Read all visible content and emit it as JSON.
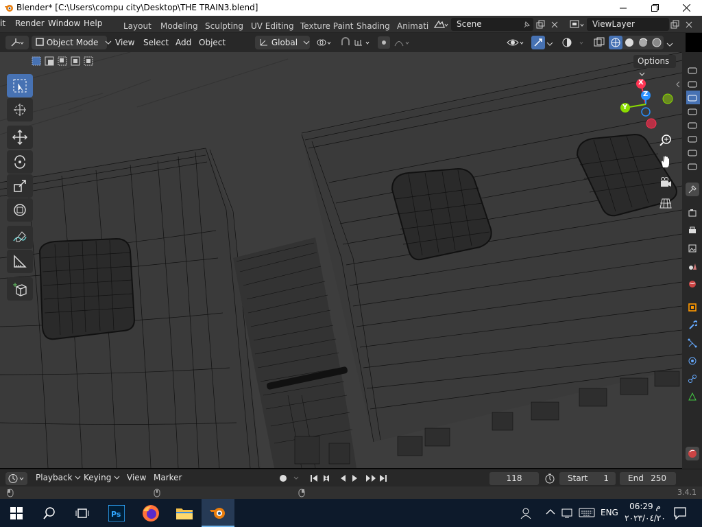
{
  "window": {
    "title": "Blender* [C:\\Users\\compu city\\Desktop\\THE TRAIN3.blend]"
  },
  "menu": {
    "items": [
      "it",
      "Render",
      "Window",
      "Help"
    ]
  },
  "workspaces": [
    "Layout",
    "Modeling",
    "Sculpting",
    "UV Editing",
    "Texture Paint",
    "Shading",
    "Animati"
  ],
  "scene": {
    "name": "Scene"
  },
  "view_layer": {
    "name": "ViewLayer"
  },
  "header": {
    "mode": "Object Mode",
    "menus": [
      "View",
      "Select",
      "Add",
      "Object"
    ],
    "transform_orientation": "Global",
    "options_label": "Options"
  },
  "gizmo": {
    "x_label": "X",
    "y_label": "Y",
    "z_label": "Z"
  },
  "timeline": {
    "menus": [
      "Playback",
      "Keying",
      "View",
      "Marker"
    ],
    "current_frame": "118",
    "start_label": "Start",
    "start_value": "1",
    "end_label": "End",
    "end_value": "250"
  },
  "status": {
    "version": "3.4.1"
  },
  "taskbar": {
    "language": "ENG",
    "time": "06:29 م",
    "date": "٢٠٢٣/٠٤/٢٠"
  },
  "colors": {
    "accent": "#4772b3",
    "axis_x": "#ff3352",
    "axis_y": "#8bdc00",
    "axis_z": "#2890ff",
    "viewport_bg": "#3c3c3c"
  }
}
